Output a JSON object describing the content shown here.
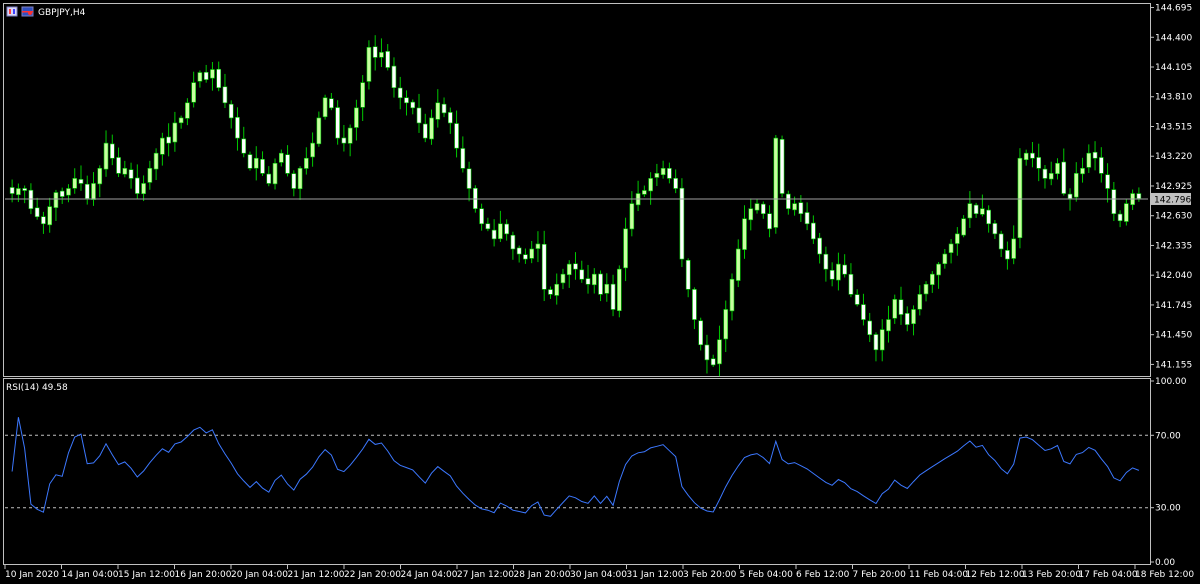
{
  "window": {
    "symbol_label": "GBPJPY,H4"
  },
  "icons": [
    "chart-window-icon",
    "currency-flags-icon"
  ],
  "colors": {
    "background": "#000000",
    "frame": "#c0c0c0",
    "bull_candle": "#c8ffa0",
    "bear_candle": "#ffffff",
    "wick": "#00c800",
    "rsi_line": "#3c78ff",
    "level_line": "#c0c0c0",
    "bid_line": "#a0a0a0",
    "current_price_box": "#c0c0c0"
  },
  "chart_data": [
    {
      "type": "candlestick",
      "title": "GBPJPY,H4",
      "ylim": [
        141.05,
        144.72
      ],
      "yticks": [
        "144.695",
        "144.400",
        "144.105",
        "143.810",
        "143.515",
        "143.220",
        "142.925",
        "142.630",
        "142.335",
        "142.040",
        "141.745",
        "141.450",
        "141.155"
      ],
      "current_price": 142.796,
      "current_price_label": "142.796",
      "xticks": [
        "10 Jan 2020",
        "14 Jan 04:00",
        "15 Jan 12:00",
        "16 Jan 20:00",
        "20 Jan 04:00",
        "21 Jan 12:00",
        "22 Jan 20:00",
        "24 Jan 04:00",
        "27 Jan 12:00",
        "28 Jan 20:00",
        "30 Jan 04:00",
        "31 Jan 12:00",
        "3 Feb 20:00",
        "5 Feb 04:00",
        "6 Feb 12:00",
        "7 Feb 20:00",
        "11 Feb 04:00",
        "12 Feb 12:00",
        "13 Feb 20:00",
        "17 Feb 04:00",
        "18 Feb 12:00"
      ],
      "close": [
        142.85,
        142.9,
        142.88,
        142.7,
        142.62,
        142.55,
        142.72,
        142.86,
        142.82,
        142.9,
        143.0,
        142.95,
        142.8,
        142.95,
        143.1,
        143.35,
        143.2,
        143.05,
        143.1,
        143.0,
        142.85,
        142.95,
        143.1,
        143.25,
        143.4,
        143.35,
        143.55,
        143.6,
        143.75,
        143.95,
        144.05,
        143.98,
        144.08,
        143.9,
        143.75,
        143.6,
        143.4,
        143.25,
        143.1,
        143.2,
        143.05,
        142.95,
        143.15,
        143.25,
        143.05,
        142.9,
        143.1,
        143.2,
        143.35,
        143.6,
        143.8,
        143.7,
        143.4,
        143.35,
        143.5,
        143.7,
        143.95,
        144.3,
        144.2,
        144.25,
        144.1,
        143.9,
        143.8,
        143.75,
        143.7,
        143.55,
        143.4,
        143.6,
        143.75,
        143.65,
        143.55,
        143.3,
        143.1,
        142.9,
        142.7,
        142.55,
        142.5,
        142.4,
        142.55,
        142.45,
        142.3,
        142.25,
        142.2,
        142.3,
        142.35,
        141.9,
        141.85,
        141.95,
        142.05,
        142.15,
        142.1,
        142.0,
        141.95,
        142.05,
        141.85,
        141.95,
        141.7,
        142.1,
        142.5,
        142.75,
        142.85,
        142.88,
        143.0,
        143.05,
        143.1,
        143.0,
        142.9,
        142.2,
        141.9,
        141.6,
        141.35,
        141.2,
        141.15,
        141.4,
        141.7,
        142.0,
        142.3,
        142.6,
        142.7,
        142.75,
        142.65,
        142.5,
        143.4,
        142.85,
        142.7,
        142.75,
        142.65,
        142.55,
        142.4,
        142.25,
        142.1,
        142.0,
        142.15,
        142.05,
        141.85,
        141.75,
        141.6,
        141.45,
        141.3,
        141.5,
        141.6,
        141.8,
        141.65,
        141.55,
        141.7,
        141.85,
        141.95,
        142.05,
        142.15,
        142.25,
        142.35,
        142.45,
        142.6,
        142.75,
        142.65,
        142.7,
        142.55,
        142.45,
        142.3,
        142.2,
        142.4,
        143.2,
        143.25,
        143.2,
        143.1,
        143.0,
        143.05,
        143.15,
        142.85,
        142.8,
        143.05,
        143.1,
        143.25,
        143.2,
        143.05,
        142.9,
        142.65,
        142.58,
        142.75,
        142.85,
        142.8
      ],
      "indicators": [
        {
          "type": "line",
          "name": "RSI(14)",
          "label": "RSI(14) 49.58",
          "ylim": [
            0,
            100
          ],
          "yticks": [
            "100.00",
            "70.00",
            "30.00",
            "0.00"
          ],
          "levels": [
            70,
            30
          ]
        }
      ]
    }
  ]
}
